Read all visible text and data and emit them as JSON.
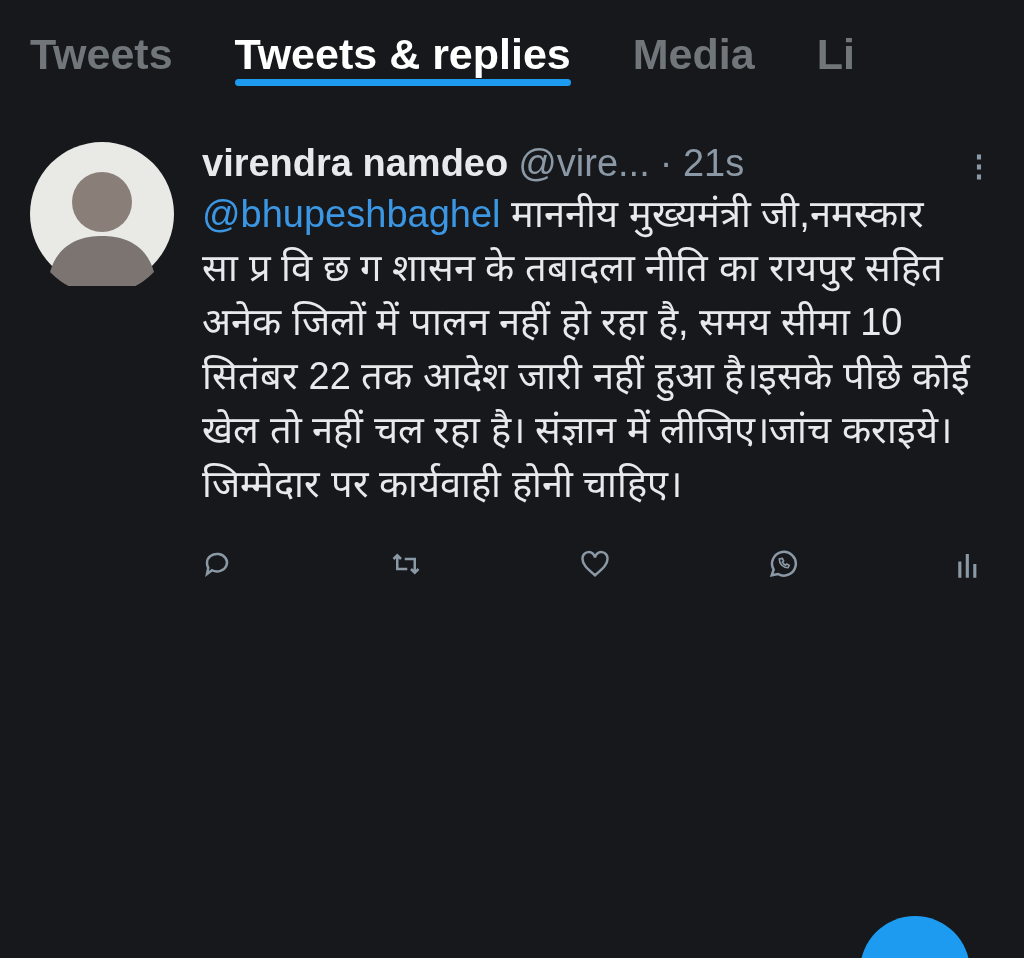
{
  "tabs": [
    {
      "label": "Tweets",
      "selected": false
    },
    {
      "label": "Tweets & replies",
      "selected": true
    },
    {
      "label": "Media",
      "selected": false
    },
    {
      "label": "Li",
      "selected": false
    }
  ],
  "tweet": {
    "name": "virendra namdeo",
    "handle": "@vire...",
    "time": "· 21s",
    "menu": "⋮",
    "mention": "@bhupeshbaghel",
    "text": "  माननीय मुख्यमंत्री जी,नमस्कार\nसा प्र वि छ ग शासन के तबादला नीति का रायपुर सहित अनेक जिलों में पालन नहीं हो रहा है, समय सीमा 10 सितंबर 22 तक आदेश जारी नहीं हुआ है।इसके पीछे कोई खेल तो नहीं चल रहा है। संज्ञान में लीजिए।जांच कराइये।जिम्मेदार पर कार्यवाही होनी चाहिए।",
    "actions": [
      {
        "kind": "reply"
      },
      {
        "kind": "retweet"
      },
      {
        "kind": "like"
      },
      {
        "kind": "share"
      },
      {
        "kind": "stats"
      }
    ]
  }
}
